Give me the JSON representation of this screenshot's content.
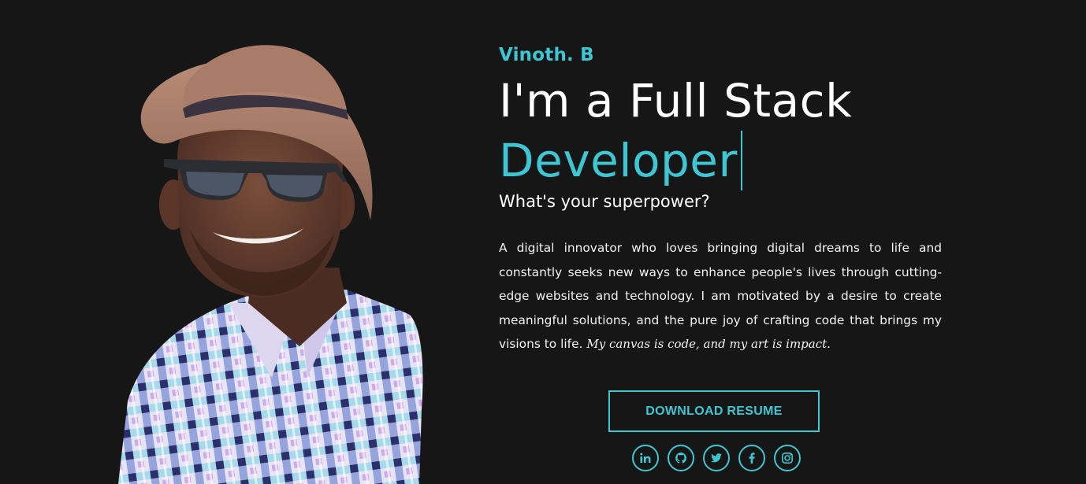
{
  "hero": {
    "name": "Vinoth. B",
    "headline_line1": "I'm a Full Stack",
    "headline_line2": "Developer",
    "subheadline": "What's your superpower?",
    "bio": "A digital innovator who loves bringing digital dreams to life and constantly seeks new ways to enhance people's lives through cutting-edge websites and technology. I am motivated by a desire to create meaningful solutions, and the pure joy of crafting code that brings my visions to life.",
    "tagline": "My canvas is code, and my art is impact.",
    "resume_button": "DOWNLOAD RESUME"
  },
  "socials": [
    {
      "icon": "linkedin-icon"
    },
    {
      "icon": "github-icon"
    },
    {
      "icon": "twitter-icon"
    },
    {
      "icon": "facebook-icon"
    },
    {
      "icon": "instagram-icon"
    }
  ],
  "colors": {
    "background": "#161616",
    "accent": "#3ec7d3",
    "text": "#ffffff"
  }
}
